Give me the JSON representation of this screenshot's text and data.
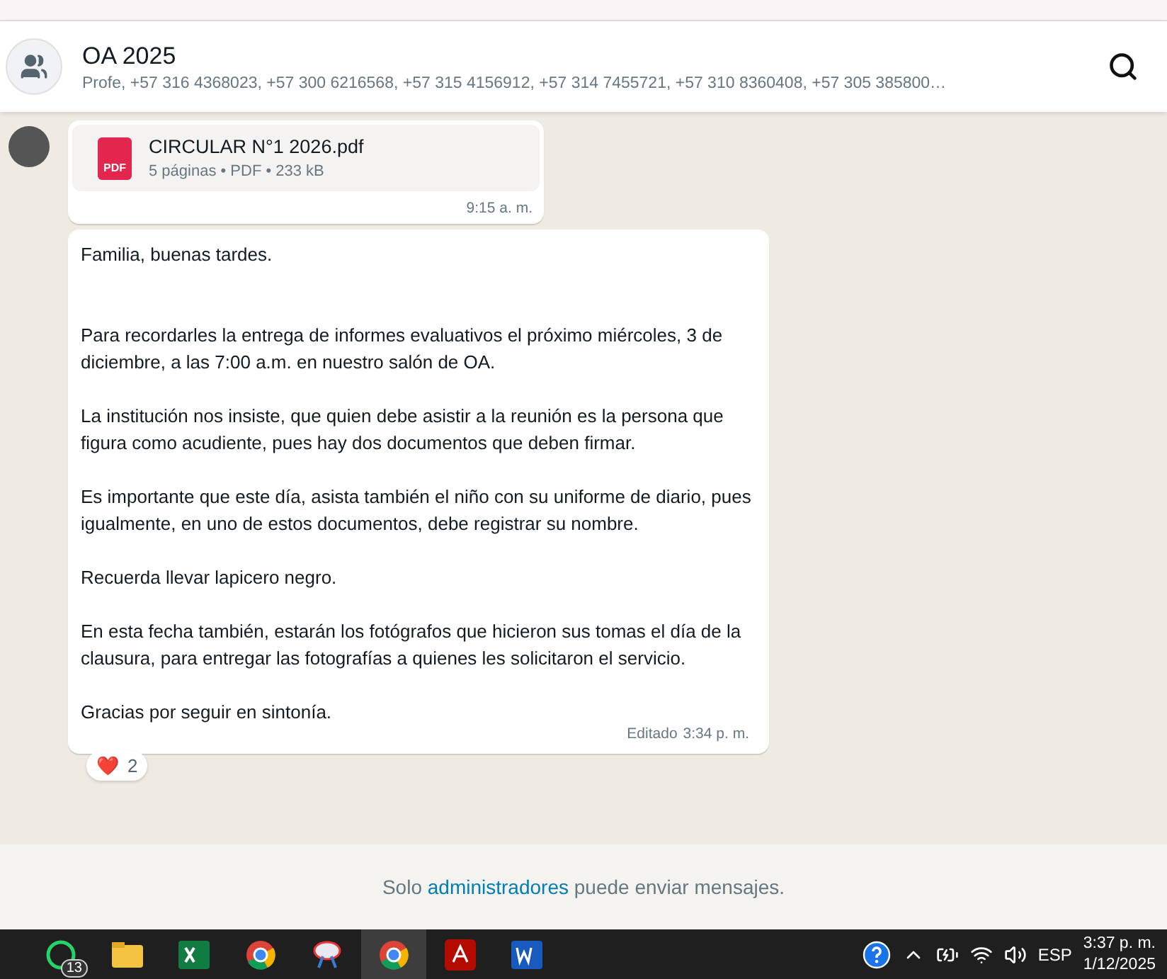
{
  "header": {
    "title": "OA 2025",
    "subtitle": "Profe, +57 316 4368023, +57 300 6216568, +57 315 4156912, +57 314 7455721, +57 310 8360408, +57 305 385800…"
  },
  "messages": [
    {
      "kind": "document",
      "file_badge": "PDF",
      "file_name": "CIRCULAR N°1 2026.pdf",
      "file_meta": "5 páginas • PDF • 233 kB",
      "time": "9:15 a. m.",
      "show_avatar": true
    },
    {
      "kind": "text",
      "lead_gap": true,
      "paragraphs": [
        "Familia, buenas tardes.",
        "Para recordarles la entrega de informes evaluativos el próximo miércoles, 3 de diciembre, a las 7:00 a.m. en nuestro salón de OA.",
        "La institución nos insiste, que quien debe asistir a la reunión es la persona que figura como acudiente, pues hay dos documentos que deben firmar.",
        "Es importante que este día, asista también el niño con su uniforme de diario, pues igualmente, en uno de estos documentos, debe registrar su nombre.",
        "Recuerda llevar lapicero negro.",
        "En esta fecha también, estarán los fotógrafos que hicieron sus tomas el día de la clausura, para entregar las fotografías a quienes les solicitaron el servicio.",
        "Gracias por seguir en sintonía."
      ],
      "edited_label": "Editado",
      "time": "3:34 p. m.",
      "reaction": {
        "emoji": "❤️",
        "count": "2"
      }
    }
  ],
  "footer": {
    "before": "Solo ",
    "link": "administradores",
    "after": " puede enviar mensajes."
  },
  "taskbar": {
    "apps": [
      {
        "kind": "whatsapp",
        "badge": "13",
        "selected": false
      },
      {
        "kind": "folder",
        "selected": false
      },
      {
        "kind": "excel",
        "selected": false
      },
      {
        "kind": "chrome",
        "selected": false
      },
      {
        "kind": "snip",
        "selected": false
      },
      {
        "kind": "chrome",
        "selected": true
      },
      {
        "kind": "acrobat",
        "selected": false
      },
      {
        "kind": "word",
        "selected": false
      }
    ],
    "language": "ESP",
    "time": "3:37 p. m.",
    "date": "1/12/2025"
  }
}
